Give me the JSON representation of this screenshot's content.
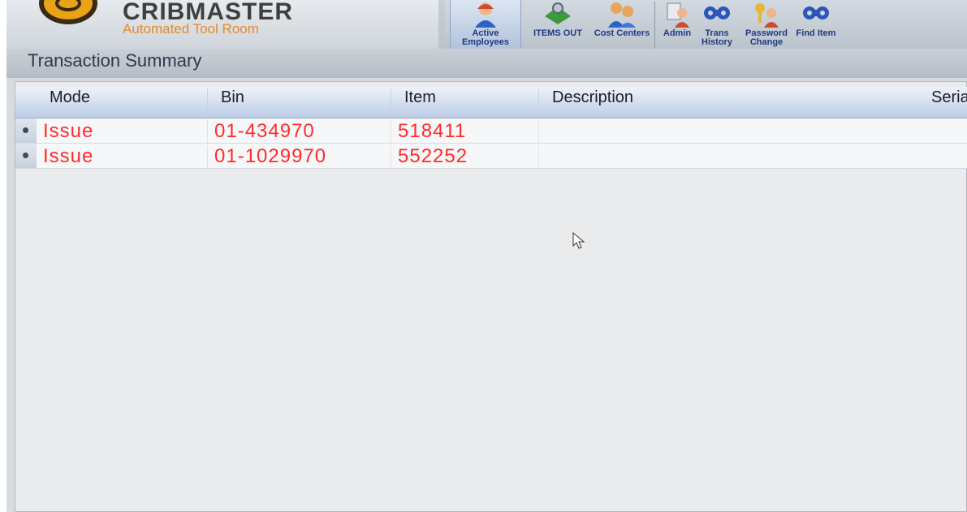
{
  "app": {
    "brand": "CRIBMASTER",
    "tagline": "Automated Tool Room"
  },
  "toolbar": {
    "items": [
      {
        "label": "Active Employees",
        "icon": "employee-icon"
      },
      {
        "label": "ITEMS OUT",
        "icon": "items-out-icon"
      },
      {
        "label": "Cost Centers",
        "icon": "cost-centers-icon"
      },
      {
        "label": "Admin",
        "icon": "admin-icon"
      },
      {
        "label": "Trans History",
        "icon": "trans-history-icon"
      },
      {
        "label": "Password Change",
        "icon": "password-icon"
      },
      {
        "label": "Find Item",
        "icon": "find-item-icon"
      }
    ]
  },
  "page": {
    "title": "Transaction Summary"
  },
  "table": {
    "columns": [
      "Mode",
      "Bin",
      "Item",
      "Description",
      "Serial"
    ],
    "rows": [
      {
        "mode": "Issue",
        "bin": "01-434970",
        "item": "518411",
        "description": ""
      },
      {
        "mode": "Issue",
        "bin": "01-1029970",
        "item": "552252",
        "description": ""
      }
    ]
  },
  "colors": {
    "accent": "#1f3a80",
    "row_text": "#ff2b2b",
    "brand_orange": "#e58a2a"
  }
}
